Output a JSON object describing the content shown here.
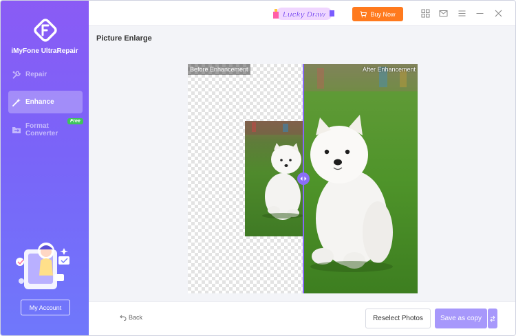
{
  "app": {
    "name": "iMyFone UltraRepair"
  },
  "sidebar": {
    "items": [
      {
        "label": "Repair",
        "icon": "tools-icon",
        "active": false
      },
      {
        "label": "Enhance",
        "icon": "magic-wand-icon",
        "active": true
      },
      {
        "label": "Format Converter",
        "icon": "folder-convert-icon",
        "active": false,
        "badge": "Free"
      }
    ],
    "account_label": "My Account"
  },
  "titlebar": {
    "promo_label": "Lucky Draw",
    "buy_label": "Buy Now",
    "icons": [
      "grid-icon",
      "mail-icon",
      "menu-icon",
      "minimize-icon",
      "close-icon"
    ]
  },
  "main": {
    "title": "Picture Enlarge",
    "before_label": "Before Enhancement",
    "after_label": "After Enhancement"
  },
  "footer": {
    "back_label": "Back",
    "reselect_label": "Reselect Photos",
    "save_label": "Save as copy"
  },
  "colors": {
    "sidebar_top": "#8a5bf5",
    "sidebar_bottom": "#6f78fb",
    "accent": "#8668f7",
    "buy": "#ff7a1e",
    "save_button": "#a798fb",
    "free_badge": "#3ec55a"
  }
}
